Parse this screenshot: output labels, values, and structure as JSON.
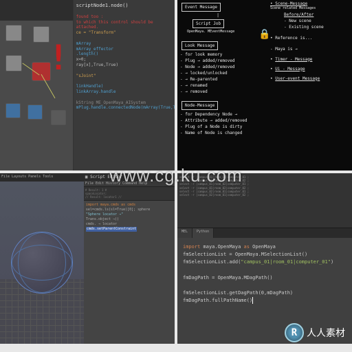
{
  "watermark": "www.cg.ku.com",
  "logo_text": "人人素材",
  "logo_initial": "R",
  "q1": {
    "title": "scriptNode1.node()",
    "lines": {
      "l1": "found too :",
      "l2": "to which this control should be attached.",
      "l3": "ce = \"Transform\"",
      "l4": "mArray",
      "l5": "mArray_effector",
      "l6": ".length()",
      "l7": "x=0;",
      "l8": "ray[x],True,True)",
      "l9": "\"sJoint\"",
      "l10": "linkHandle)",
      "l11": "linkArray.handle",
      "l12": "kString ME_OpenMaya_AISystem",
      "l13": "mPlug.handle.connectedNode(mArray(True,True))"
    }
  },
  "q2": {
    "event_msg_title": "Event Message",
    "event_box": "Script Job",
    "event_sub": "OpenMaya. MEventMessage",
    "look_title": "Look Message",
    "look_items": [
      "- for look memory",
      "- Plug → added/removed",
      "- Node → added/removed",
      "- → locked/unlocked",
      "- → Re-parented",
      "- → renamed",
      "- → removed"
    ],
    "node_title": "Node-Message",
    "node_items": [
      "- for Dependency Node →",
      "- Attribute → added/removed",
      "- Plug of a Node is dirty",
      "- Name of Node is changed"
    ],
    "scene_title": "Scene-Message",
    "scene_sub": "Scene related Messages",
    "scene_before": "Before/After",
    "scene_items": [
      "- New scene",
      "- Existing scene"
    ],
    "ref_title": "Reference is...",
    "maya_title": "- Maya is →",
    "timer_title": "Timer - Message",
    "ui_title": "Ui - Message",
    "user_title": "User-event Message"
  },
  "q3": {
    "menu": "File  Layouts  Panels  Tools",
    "se_title": "Script Editor",
    "se_menu": "File  Edit  History  Command  Help",
    "hist_lines": [
      "# Result: 1 #",
      "spaceLocator;",
      "// Result: locator1 //"
    ],
    "code": {
      "c1": "import maya.cmds as cmds",
      "c2": "sel=cmds.ls(sl=True)[0]; sphere",
      "c3": "\"Sphere locator →\"",
      "c4": "Trans.object →()",
      "c5": "cmds. → locator",
      "c6": "cmds.setParentConstraint"
    }
  },
  "q4": {
    "top_lines": [
      "select -r |campus_01|room_01|computer_01 ;",
      "select -r |campus_01|room_01|computer_02 ;",
      "select -r |campus_01|room_02|computer_01 ;",
      "select -r |campus_01|room_02|computer_02 ;",
      "select -r |campus_02|room_01|computer_01 ;",
      "select -r |campus_02|room_01|computer_02 ;"
    ],
    "tab1": "MEL",
    "tab2": "Python",
    "code": {
      "l1a": "import",
      "l1b": " maya.OpenMaya ",
      "l1c": "as",
      "l1d": " OpenMaya",
      "l2": "fmSelectionList = OpenMaya.MSelectionList()",
      "l3a": "fmSelectionList.add(",
      "l3b": "\"campus_01|room_01|computer_01\"",
      "l3c": ")",
      "l4": "fmDagPath = OpenMaya.MDagPath()",
      "l5": "fmSelectionList.getDagPath(0,mDagPath)",
      "l6": "fmDagPath.fullPathName()"
    }
  }
}
